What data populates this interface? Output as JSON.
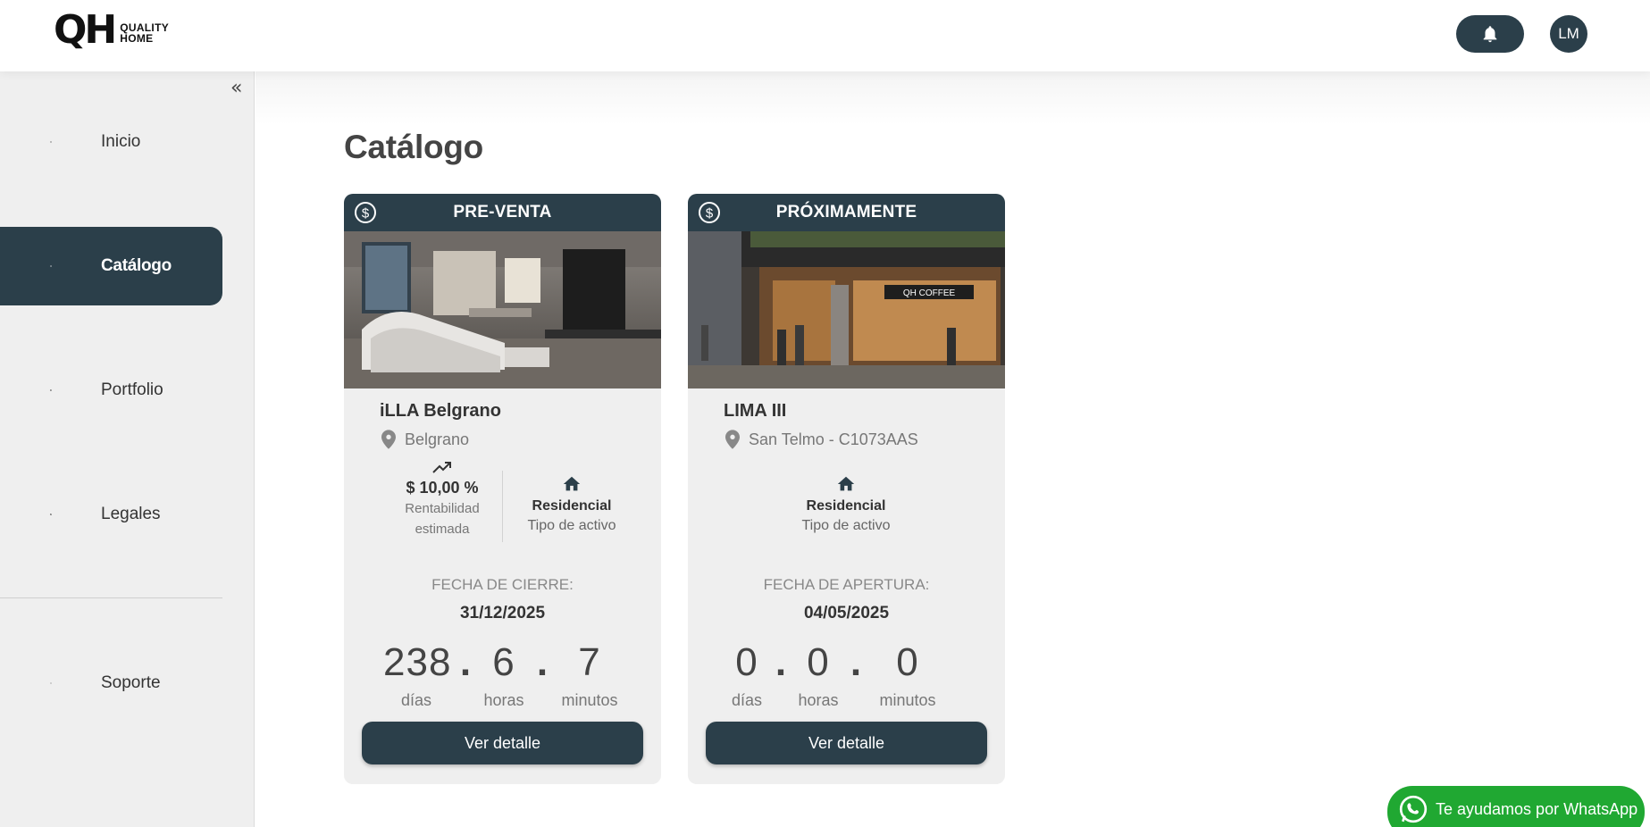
{
  "header": {
    "logo_mark": "QH",
    "logo_text_line1": "QUALITY",
    "logo_text_line2": "HOME",
    "avatar_initials": "LM"
  },
  "sidebar": {
    "collapse_glyph": "«",
    "items": [
      {
        "label": "Inicio",
        "icon": "home-icon",
        "active": false
      },
      {
        "label": "Catálogo",
        "icon": "grid-icon",
        "active": true
      },
      {
        "label": "Portfolio",
        "icon": "pie-chart-icon",
        "active": false
      },
      {
        "label": "Legales",
        "icon": "document-icon",
        "active": false
      },
      {
        "label": "Soporte",
        "icon": "support-icon",
        "active": false
      }
    ]
  },
  "main": {
    "title": "Catálogo",
    "cards": [
      {
        "status": "PRE-VENTA",
        "name": "iLLA Belgrano",
        "location": "Belgrano",
        "rentability_value": "$ 10,00 %",
        "rentability_label_1": "Rentabilidad",
        "rentability_label_2": "estimada",
        "asset_type": "Residencial",
        "asset_type_label": "Tipo de activo",
        "date_label": "FECHA DE CIERRE:",
        "date_value": "31/12/2025",
        "countdown": {
          "days": "238",
          "hours": "6",
          "minutes": "7"
        },
        "units": {
          "days": "días",
          "hours": "horas",
          "minutes": "minutos"
        },
        "button": "Ver detalle"
      },
      {
        "status": "PRÓXIMAMENTE",
        "name": "LIMA III",
        "location": "San Telmo - C1073AAS",
        "asset_type": "Residencial",
        "asset_type_label": "Tipo de activo",
        "date_label": "FECHA DE APERTURA:",
        "date_value": "04/05/2025",
        "image_sign": "QH COFFEE",
        "countdown": {
          "days": "0",
          "hours": "0",
          "minutes": "0"
        },
        "units": {
          "days": "días",
          "hours": "horas",
          "minutes": "minutos"
        },
        "button": "Ver detalle"
      }
    ]
  },
  "whatsapp": {
    "label": "Te ayudamos por WhatsApp"
  },
  "colors": {
    "primary": "#2b3f4a",
    "whatsapp": "#20a832",
    "sidebar_bg": "#efefef"
  }
}
